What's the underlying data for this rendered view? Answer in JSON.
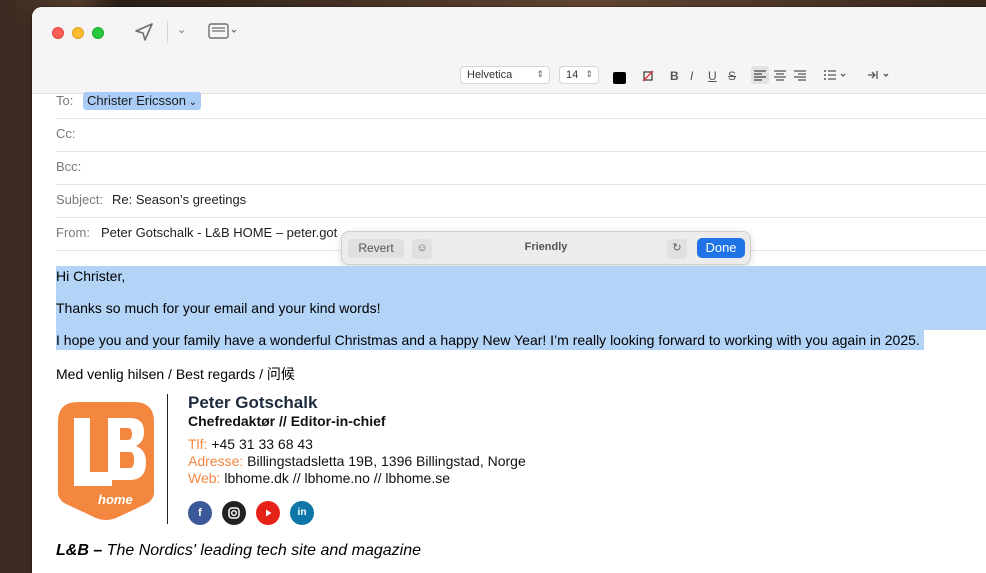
{
  "format": {
    "font": "Helvetica",
    "size": "14",
    "bold": "B",
    "italic": "I",
    "underline": "U",
    "strike": "S"
  },
  "fields": {
    "to_label": "To:",
    "to_value": "Christer Ericsson",
    "cc_label": "Cc:",
    "bcc_label": "Bcc:",
    "subject_label": "Subject:",
    "subject_value": "Re: Season’s greetings",
    "from_label": "From:",
    "from_value": "Peter Gotschalk - L&B HOME – peter.got"
  },
  "rewrite": {
    "revert": "Revert",
    "tone": "Friendly",
    "done": "Done"
  },
  "message": {
    "greeting": "Hi Christer,",
    "p1": "Thanks so much for your email and your kind words!",
    "p2": "I hope you and your family have a wonderful Christmas and a happy New Year! I’m really looking forward to working with you again in 2025.",
    "signoff": "Med venlig hilsen / Best regards / 问候"
  },
  "signature": {
    "name": "Peter Gotschalk",
    "role": "Chefredaktør // Editor-in-chief",
    "phone_label": "Tlf:",
    "phone": "+45 31 33 68 43",
    "address_label": "Adresse:",
    "address": "Billingstadsletta 19B, 1396 Billingstad, Norge",
    "web_label": "Web:",
    "web": "lbhome.dk // lbhome.no // lbhome.se",
    "logo_text": "home",
    "tagline_brand": "L&B –",
    "tagline_rest": " The Nordics' leading tech site and magazine"
  },
  "colors": {
    "accent": "#1f73e6",
    "brand_orange": "#f3873f",
    "selection": "#b4d4f7"
  }
}
